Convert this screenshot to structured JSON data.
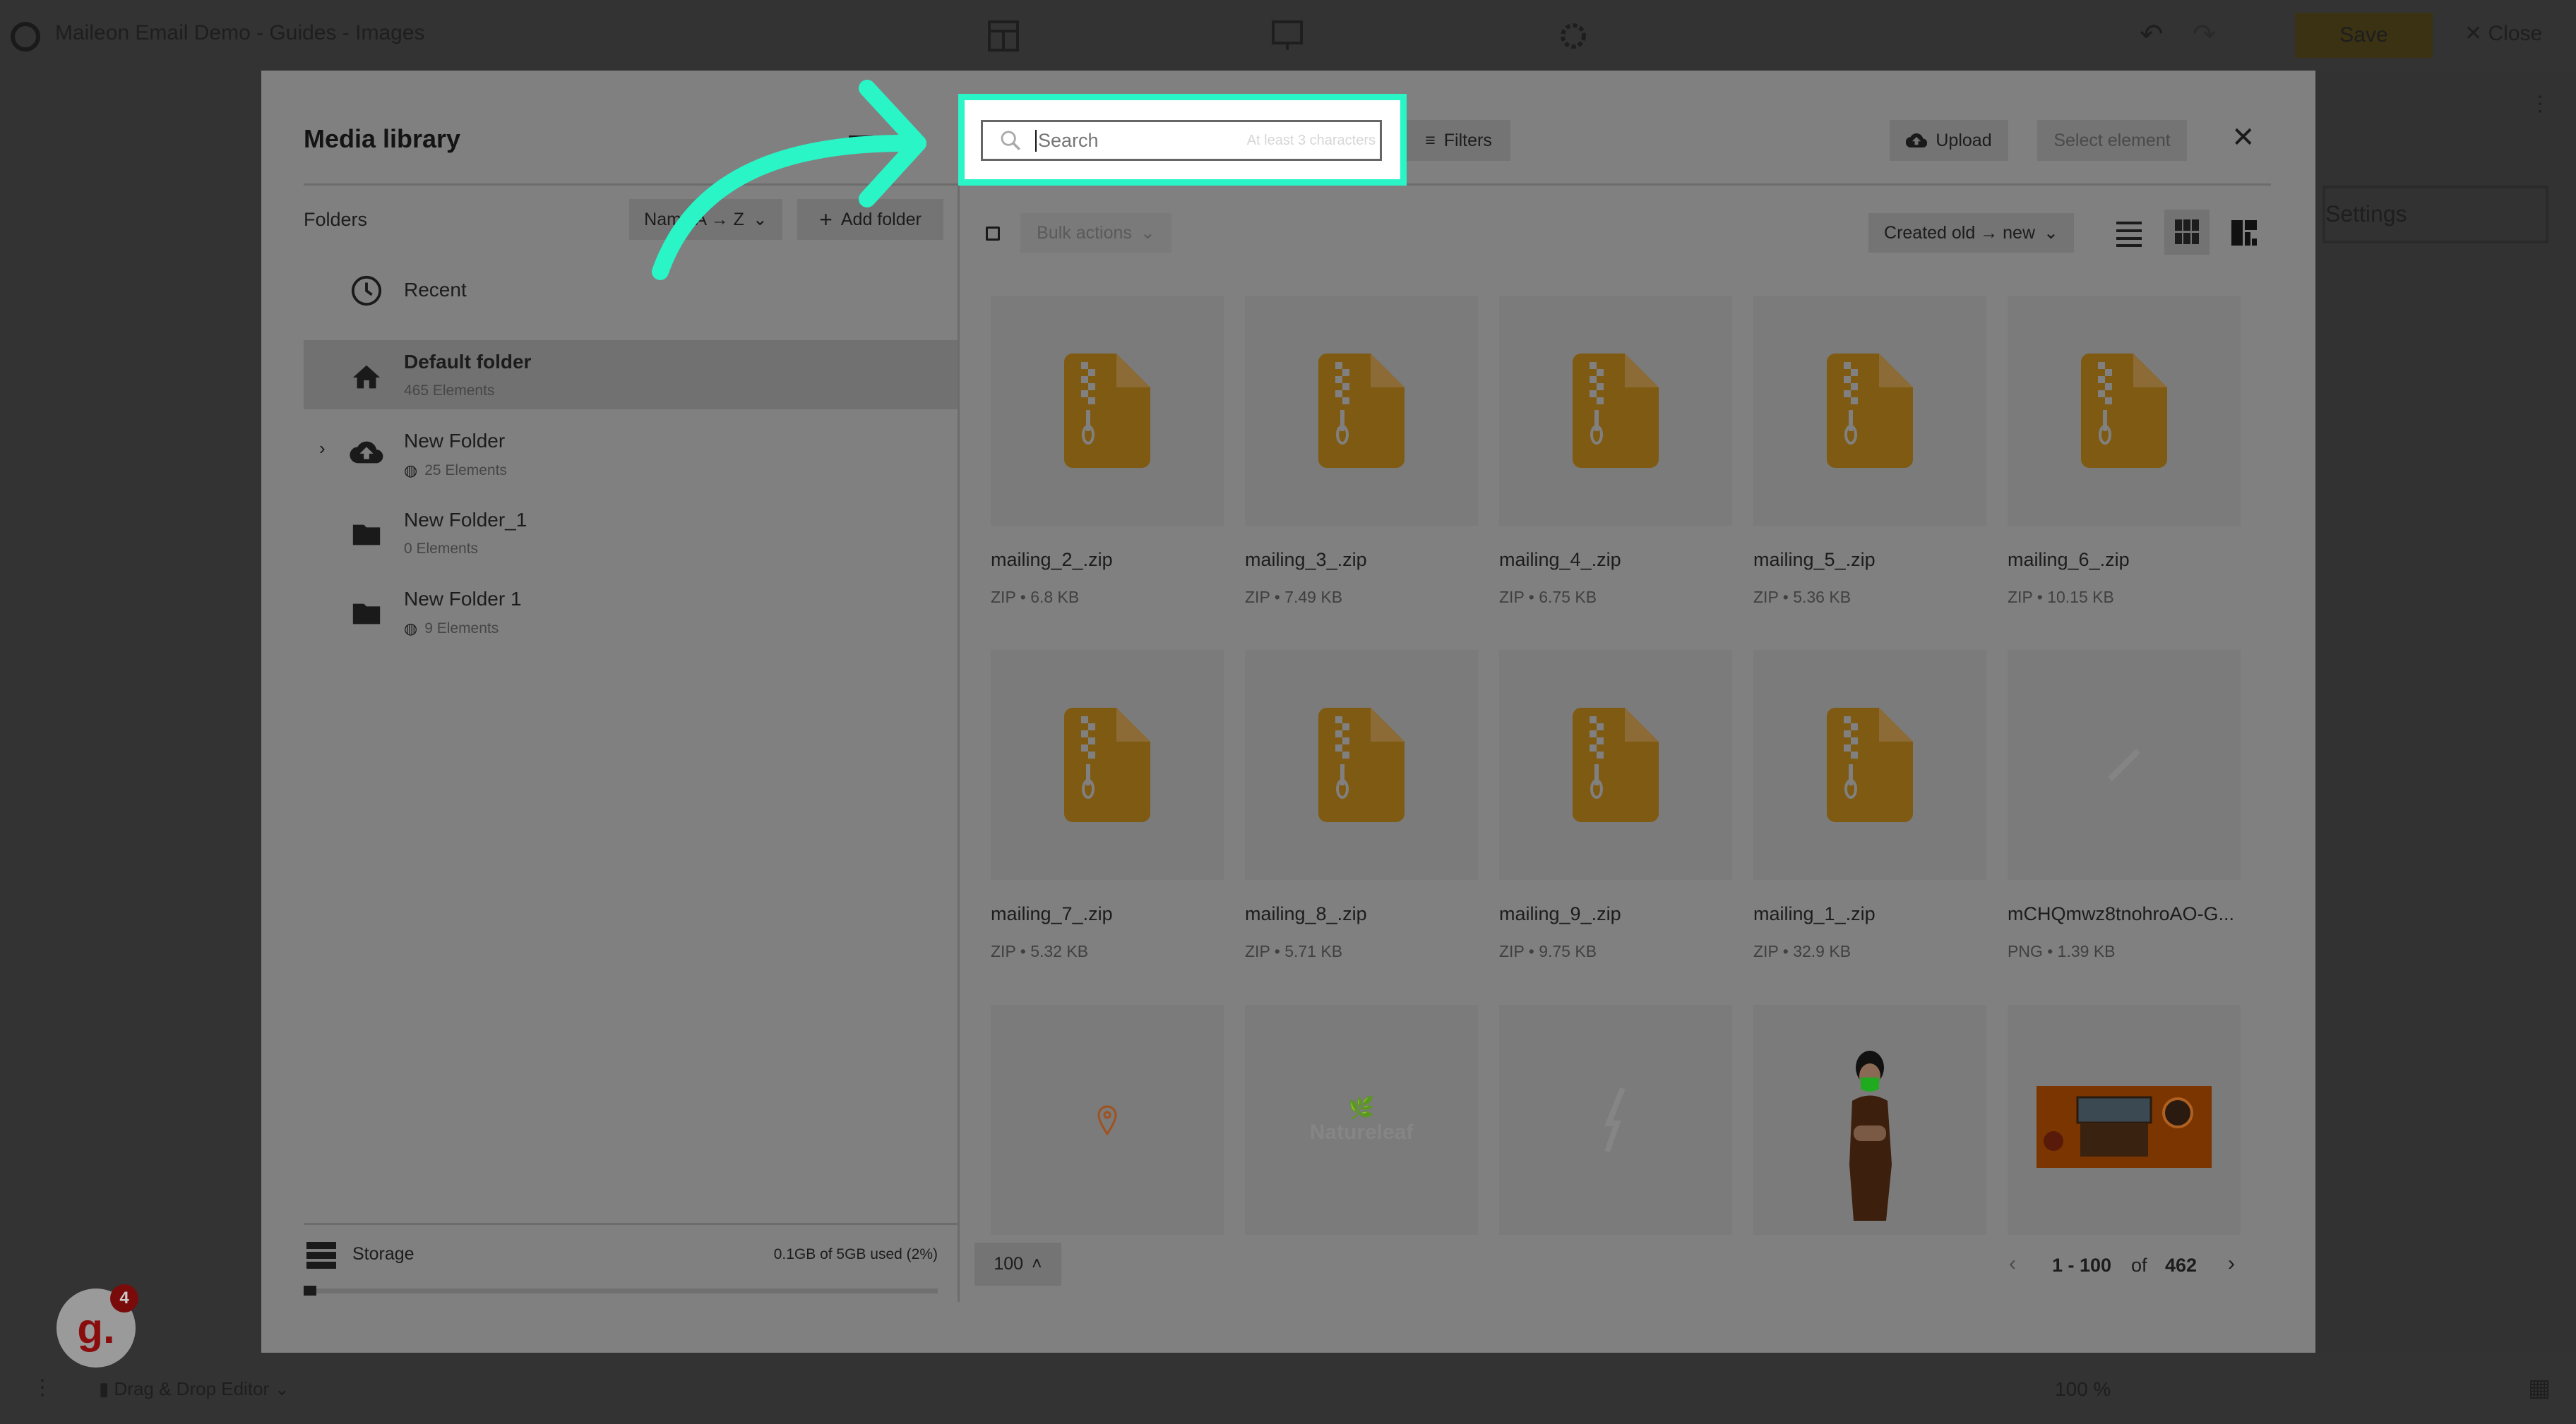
{
  "app": {
    "title": "Maileon Email Demo - Guides - Images",
    "save": "Save",
    "close": "Close",
    "settings": "Settings",
    "editor_mode": "Drag & Drop Editor",
    "zoom": "100 %",
    "badge_count": "4",
    "brand_letter": "g."
  },
  "modal": {
    "title": "Media library",
    "folders_label": "Folders",
    "sort_label": "Name A → Z",
    "add_folder": "Add folder",
    "folders": [
      {
        "name": "Recent",
        "icon": "clock-icon"
      },
      {
        "name": "Default folder",
        "count": "465 Elements",
        "icon": "home-icon",
        "selected": true
      },
      {
        "name": "New Folder",
        "count": "25 Elements",
        "icon": "cloud-upload-icon",
        "public": true,
        "expandable": true
      },
      {
        "name": "New Folder_1",
        "count": "0 Elements",
        "icon": "folder-icon"
      },
      {
        "name": "New Folder 1",
        "count": "9 Elements",
        "icon": "folder-icon",
        "public": true
      }
    ],
    "storage": {
      "label": "Storage",
      "usage": "0.1GB of 5GB used (2%)",
      "percent": 2
    },
    "search": {
      "value": "",
      "placeholder": "Search",
      "hint": "At least 3 characters"
    },
    "filters": "Filters",
    "upload": "Upload",
    "select_element": "Select element",
    "bulk_actions": "Bulk actions",
    "sort_files": "Created old → new",
    "view_mode": "grid",
    "files": [
      {
        "name": "mailing_2_.zip",
        "type": "ZIP",
        "size": "6.8 KB",
        "thumb": "zip"
      },
      {
        "name": "mailing_3_.zip",
        "type": "ZIP",
        "size": "7.49 KB",
        "thumb": "zip"
      },
      {
        "name": "mailing_4_.zip",
        "type": "ZIP",
        "size": "6.75 KB",
        "thumb": "zip"
      },
      {
        "name": "mailing_5_.zip",
        "type": "ZIP",
        "size": "5.36 KB",
        "thumb": "zip"
      },
      {
        "name": "mailing_6_.zip",
        "type": "ZIP",
        "size": "10.15 KB",
        "thumb": "zip"
      },
      {
        "name": "mailing_7_.zip",
        "type": "ZIP",
        "size": "5.32 KB",
        "thumb": "zip"
      },
      {
        "name": "mailing_8_.zip",
        "type": "ZIP",
        "size": "5.71 KB",
        "thumb": "zip"
      },
      {
        "name": "mailing_9_.zip",
        "type": "ZIP",
        "size": "9.75 KB",
        "thumb": "zip"
      },
      {
        "name": "mailing_1_.zip",
        "type": "ZIP",
        "size": "32.9 KB",
        "thumb": "zip"
      },
      {
        "name": "mCHQmwz8tnohroAO-G...",
        "type": "PNG",
        "size": "1.39 KB",
        "thumb": "blank"
      },
      {
        "thumb": "pin"
      },
      {
        "thumb": "logo",
        "logo_text": "Natureleaf"
      },
      {
        "thumb": "bolt"
      },
      {
        "thumb": "woman"
      },
      {
        "thumb": "laptop"
      }
    ],
    "page_size": "100",
    "pagination": {
      "range": "1 - 100",
      "of": "of",
      "total": "462"
    }
  },
  "colors": {
    "highlight": "#29f5c6",
    "zip": "#7f5a12",
    "overlay_modal": "#808080"
  }
}
